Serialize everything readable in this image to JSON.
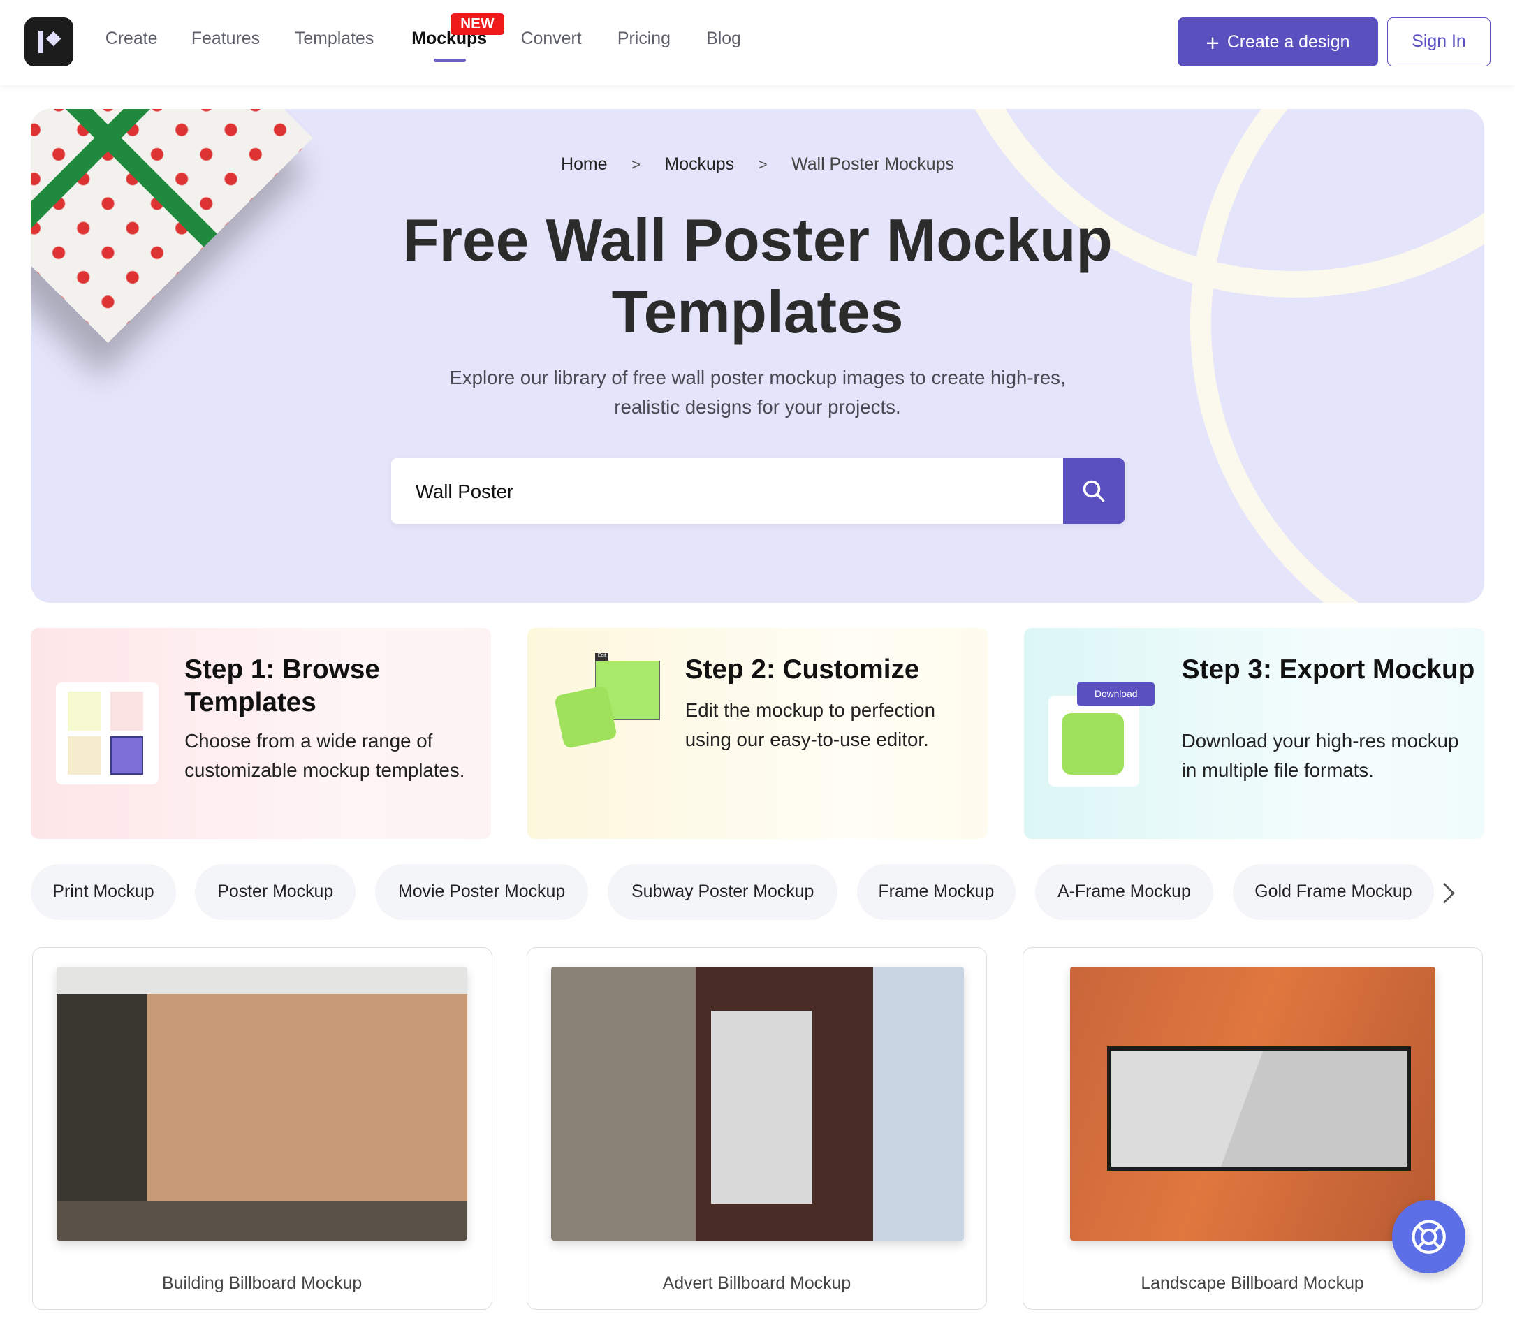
{
  "header": {
    "logo": "logo",
    "nav": [
      "Create",
      "Features",
      "Templates",
      "Mockups",
      "Convert",
      "Pricing",
      "Blog"
    ],
    "active": "Mockups",
    "new_badge": "NEW",
    "create_button": "Create a design",
    "sign_in": "Sign In"
  },
  "hero": {
    "breadcrumb": [
      "Home",
      "Mockups",
      "Wall Poster Mockups"
    ],
    "breadcrumb_sep": ">",
    "title_line1": "Free Wall Poster Mockup",
    "title_line2": "Templates",
    "desc_line1": "Explore our library of free wall poster mockup images to create high-res,",
    "desc_line2": "realistic designs for your projects.",
    "search_value": "Wall Poster",
    "search_icon": "search-icon"
  },
  "steps": [
    {
      "title": "Step 1: Browse Templates",
      "text": "Choose from a wide range of customizable mockup templates."
    },
    {
      "title": "Step 2: Customize",
      "text": "Edit the mockup to perfection using our easy-to-use editor.",
      "thumb_label": "Edit"
    },
    {
      "title": "Step 3: Export Mockup",
      "text": "Download your high-res mockup in multiple file formats.",
      "thumb_label": "Download"
    }
  ],
  "chips": [
    "Print Mockup",
    "Poster Mockup",
    "Movie Poster Mockup",
    "Subway Poster Mockup",
    "Frame Mockup",
    "A-Frame Mockup",
    "Gold Frame Mockup"
  ],
  "cards": [
    {
      "caption": "Building Billboard Mockup"
    },
    {
      "caption": "Advert Billboard Mockup"
    },
    {
      "caption": "Landscape Billboard Mockup"
    }
  ],
  "colors": {
    "accent": "#5b50c0",
    "hero_bg": "#e4e4fa",
    "new_badge": "#ef1b1b",
    "help": "#5c6fe6"
  }
}
